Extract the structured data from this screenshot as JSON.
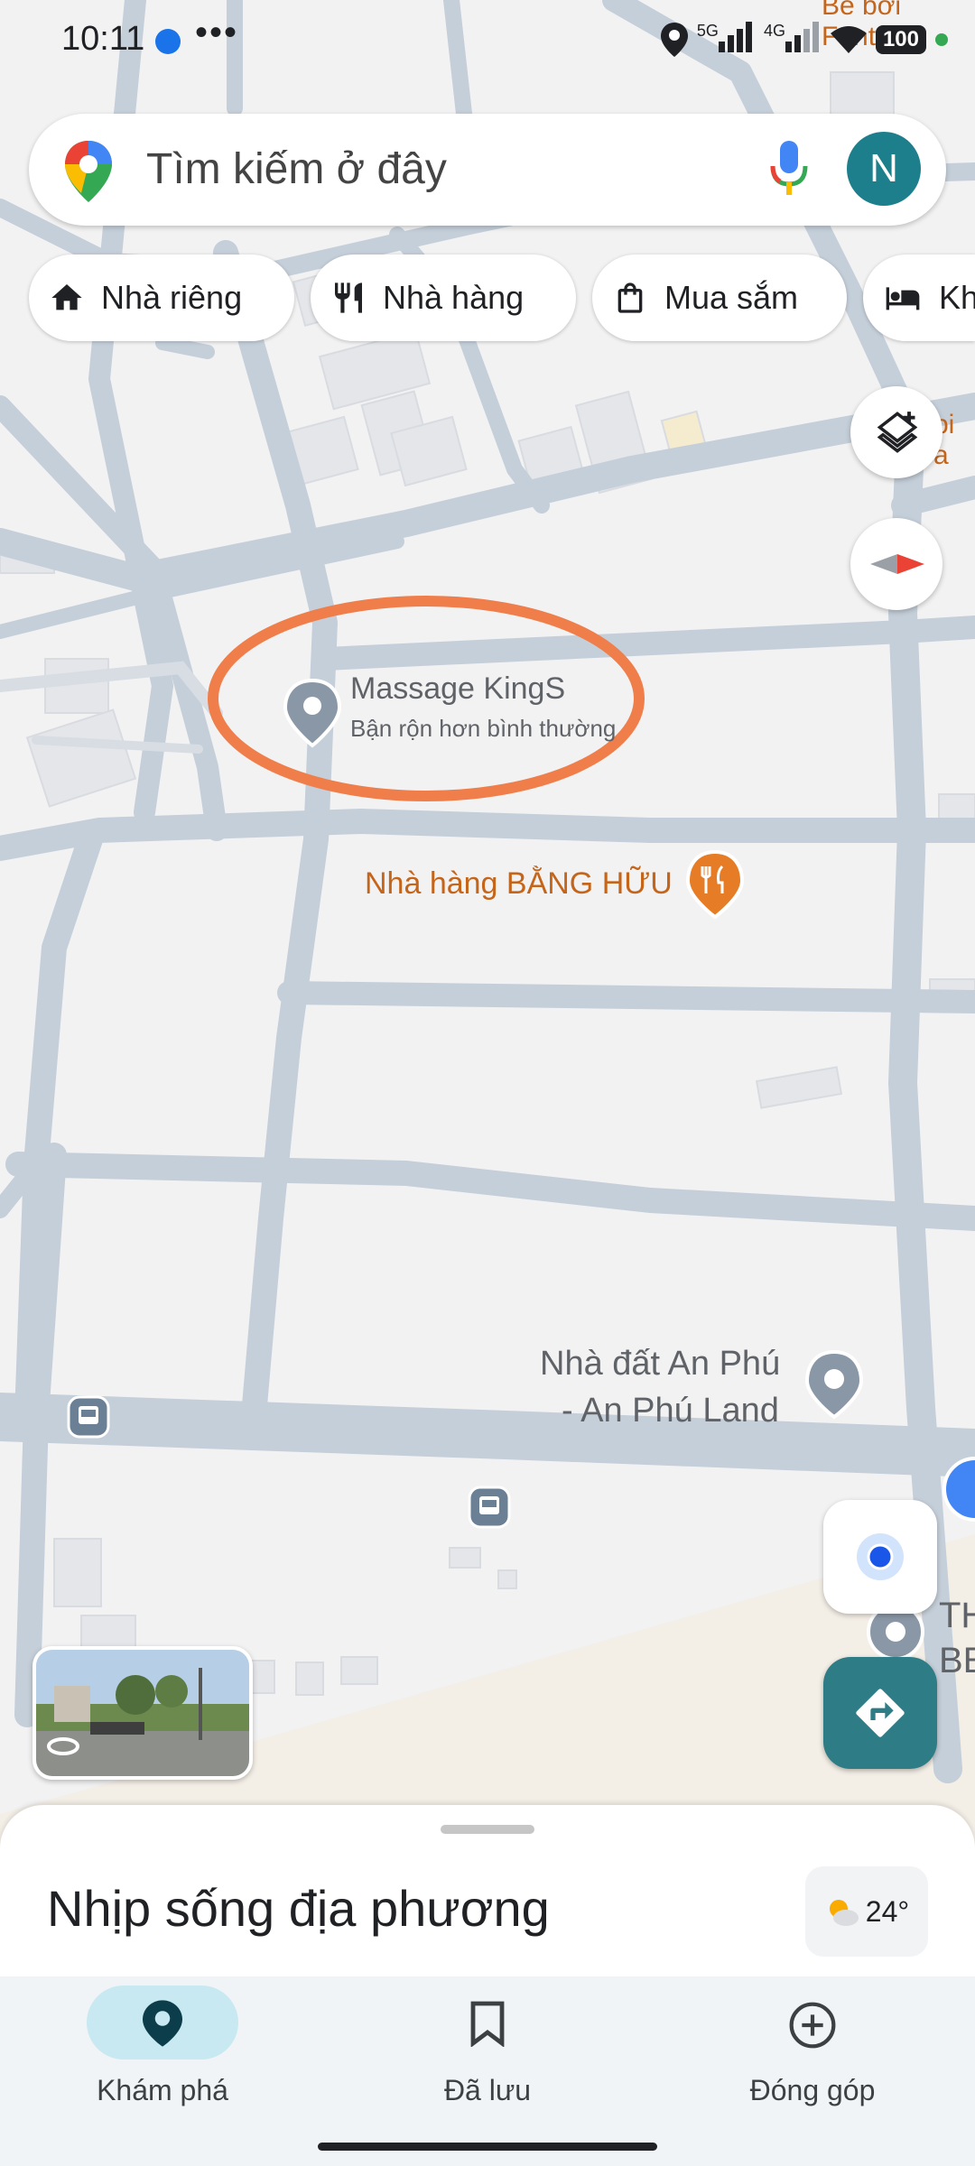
{
  "status_bar": {
    "time": "10:11",
    "dots": "•••",
    "net_5g": "5G",
    "net_4g": "4G",
    "battery": "100"
  },
  "search": {
    "placeholder": "Tìm kiếm ở đây",
    "avatar_letter": "N"
  },
  "chips": [
    {
      "label": "Nhà riêng",
      "icon": "home-icon"
    },
    {
      "label": "Nhà hàng",
      "icon": "restaurant-icon"
    },
    {
      "label": "Mua sắm",
      "icon": "shopping-bag-icon"
    },
    {
      "label": "Kh",
      "icon": "hotel-icon"
    }
  ],
  "map": {
    "top_right_label": "Be bơi Fantas",
    "side_label": "bi a",
    "massage_name": "Massage KingS",
    "massage_status": "Bận rộn hơn bình thường",
    "restaurant": "Nhà hàng BẰNG HỮU",
    "anphu_line1": "Nhà đất An Phú",
    "anphu_line2": "- An Phú Land",
    "edge_label_1": "TH",
    "edge_label_2": "BE"
  },
  "sheet": {
    "title": "Nhịp sống địa phương",
    "temperature": "24°"
  },
  "nav": {
    "explore": "Khám phá",
    "saved": "Đã lưu",
    "contribute": "Đóng góp"
  },
  "colors": {
    "road": "#c5cfd9",
    "road_light": "#d4dbe2",
    "accent_teal": "#2e7c86",
    "annotation": "#ef7e4a",
    "restaurant": "#e67c26"
  }
}
